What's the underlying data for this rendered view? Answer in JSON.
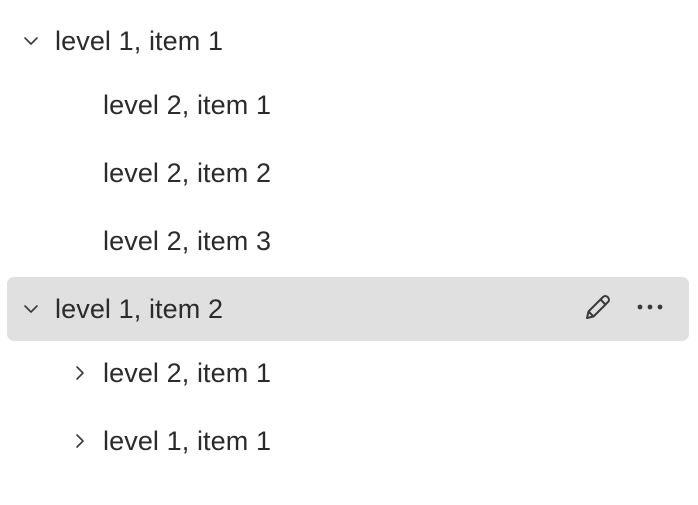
{
  "tree": {
    "nodes": [
      {
        "label": "level 1, item 1",
        "level": 1,
        "chevron": "chevron-down-icon",
        "selected": false
      },
      {
        "label": "level 2, item 1",
        "level": 2,
        "chevron": null,
        "selected": false
      },
      {
        "label": "level 2, item 2",
        "level": 2,
        "chevron": null,
        "selected": false
      },
      {
        "label": "level 2, item 3",
        "level": 2,
        "chevron": null,
        "selected": false
      },
      {
        "label": "level 1, item 2",
        "level": 1,
        "chevron": "chevron-down-icon",
        "selected": true
      },
      {
        "label": "level 2, item 1",
        "level": 2,
        "chevron": "chevron-right-icon",
        "selected": false
      },
      {
        "label": "level 1, item 1",
        "level": 2,
        "chevron": "chevron-right-icon",
        "selected": false
      }
    ],
    "row_actions": [
      {
        "icon": "pencil-icon"
      },
      {
        "icon": "more-icon"
      }
    ]
  },
  "colors": {
    "text": "#2b2b2b",
    "selected_background": "#e0e0e0",
    "icon": "#3a3a3a"
  }
}
